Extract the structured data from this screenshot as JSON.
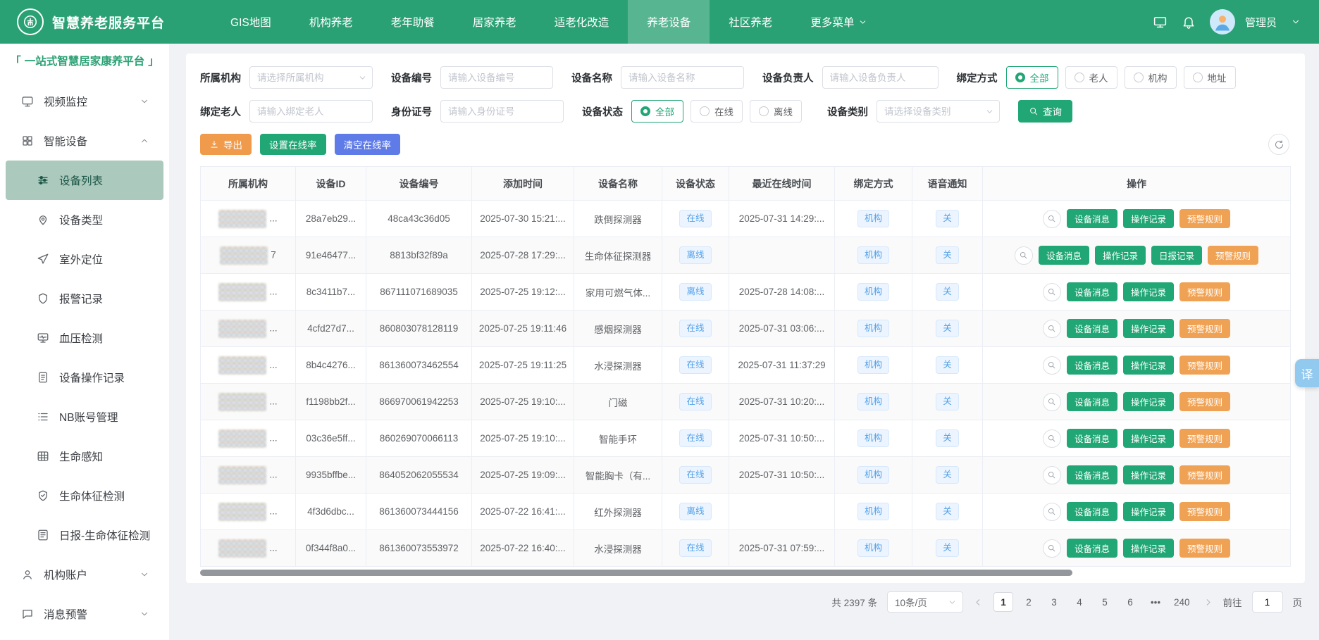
{
  "topbar": {
    "title": "智慧养老服务平台",
    "nav_items": [
      {
        "label": "GIS地图"
      },
      {
        "label": "机构养老"
      },
      {
        "label": "老年助餐"
      },
      {
        "label": "居家养老"
      },
      {
        "label": "适老化改造"
      },
      {
        "label": "养老设备",
        "active": true
      },
      {
        "label": "社区养老"
      },
      {
        "label": "更多菜单",
        "chevron": true
      }
    ],
    "user_name": "管理员"
  },
  "sidebar": {
    "bracket_left": "「",
    "platform_title": "一站式智慧居家康养平台",
    "bracket_right": "」",
    "items": [
      {
        "label": "视频监控",
        "icon": "monitor",
        "level": 1,
        "chevron": "down"
      },
      {
        "label": "智能设备",
        "icon": "grid",
        "level": 1,
        "chevron": "up"
      },
      {
        "label": "设备列表",
        "icon": "sliders",
        "level": 2,
        "active": true
      },
      {
        "label": "设备类型",
        "icon": "pin",
        "level": 2
      },
      {
        "label": "室外定位",
        "icon": "send",
        "level": 2
      },
      {
        "label": "报警记录",
        "icon": "shield",
        "level": 2
      },
      {
        "label": "血压检测",
        "icon": "pulse",
        "level": 2
      },
      {
        "label": "设备操作记录",
        "icon": "doc",
        "level": 2
      },
      {
        "label": "NB账号管理",
        "icon": "list",
        "level": 2
      },
      {
        "label": "生命感知",
        "icon": "table",
        "level": 2
      },
      {
        "label": "生命体征检测",
        "icon": "shieldcheck",
        "level": 2
      },
      {
        "label": "日报-生命体征检测",
        "icon": "report",
        "level": 2
      },
      {
        "label": "机构账户",
        "icon": "user",
        "level": 1,
        "chevron": "down"
      },
      {
        "label": "消息预警",
        "icon": "chat",
        "level": 1,
        "chevron": "down"
      }
    ]
  },
  "filters": {
    "org": {
      "label": "所属机构",
      "placeholder": "请选择所属机构"
    },
    "device_no": {
      "label": "设备编号",
      "placeholder": "请输入设备编号"
    },
    "device_name": {
      "label": "设备名称",
      "placeholder": "请输入设备名称"
    },
    "device_owner": {
      "label": "设备负责人",
      "placeholder": "请输入设备负责人"
    },
    "bind_mode": {
      "label": "绑定方式",
      "options": [
        "全部",
        "老人",
        "机构",
        "地址"
      ],
      "selected": "全部"
    },
    "bind_elder": {
      "label": "绑定老人",
      "placeholder": "请输入绑定老人"
    },
    "id_card": {
      "label": "身份证号",
      "placeholder": "请输入身份证号"
    },
    "device_status": {
      "label": "设备状态",
      "options": [
        "全部",
        "在线",
        "离线"
      ],
      "selected": "全部"
    },
    "device_type": {
      "label": "设备类别",
      "placeholder": "请选择设备类别"
    },
    "search_label": "查询"
  },
  "toolbar": {
    "export_label": "导出",
    "set_online_label": "设置在线率",
    "clear_online_label": "清空在线率"
  },
  "table": {
    "headers": [
      "所属机构",
      "设备ID",
      "设备编号",
      "添加时间",
      "设备名称",
      "设备状态",
      "最近在线时间",
      "绑定方式",
      "语音通知",
      "操作"
    ],
    "rows": [
      {
        "org": "...",
        "device_id": "28a7eb29...",
        "device_no": "48ca43c36d05",
        "added": "2025-07-30 15:21:...",
        "name": "跌倒探测器",
        "status": "在线",
        "last_online": "2025-07-31 14:29:...",
        "bind": "机构",
        "voice": "关",
        "actions": [
          {
            "label": "设备消息",
            "style": "green"
          },
          {
            "label": "操作记录",
            "style": "green"
          },
          {
            "label": "预警规则",
            "style": "orange"
          }
        ]
      },
      {
        "org": "7",
        "device_id": "91e46477...",
        "device_no": "8813bf32f89a",
        "added": "2025-07-28 17:29:...",
        "name": "生命体征探测器",
        "status": "离线",
        "last_online": "",
        "bind": "机构",
        "voice": "关",
        "actions": [
          {
            "label": "设备消息",
            "style": "green"
          },
          {
            "label": "操作记录",
            "style": "green"
          },
          {
            "label": "日报记录",
            "style": "green"
          },
          {
            "label": "预警规则",
            "style": "orange"
          }
        ]
      },
      {
        "org": "...",
        "device_id": "8c3411b7...",
        "device_no": "867111071689035",
        "added": "2025-07-25 19:12:...",
        "name": "家用可燃气体...",
        "status": "离线",
        "last_online": "2025-07-28 14:08:...",
        "bind": "机构",
        "voice": "关",
        "actions": [
          {
            "label": "设备消息",
            "style": "green"
          },
          {
            "label": "操作记录",
            "style": "green"
          },
          {
            "label": "预警规则",
            "style": "orange"
          }
        ]
      },
      {
        "org": "...",
        "device_id": "4cfd27d7...",
        "device_no": "860803078128119",
        "added": "2025-07-25 19:11:46",
        "name": "感烟探测器",
        "status": "在线",
        "last_online": "2025-07-31 03:06:...",
        "bind": "机构",
        "voice": "关",
        "actions": [
          {
            "label": "设备消息",
            "style": "green"
          },
          {
            "label": "操作记录",
            "style": "green"
          },
          {
            "label": "预警规则",
            "style": "orange"
          }
        ]
      },
      {
        "org": "...",
        "device_id": "8b4c4276...",
        "device_no": "861360073462554",
        "added": "2025-07-25 19:11:25",
        "name": "水浸探测器",
        "status": "在线",
        "last_online": "2025-07-31 11:37:29",
        "bind": "机构",
        "voice": "关",
        "actions": [
          {
            "label": "设备消息",
            "style": "green"
          },
          {
            "label": "操作记录",
            "style": "green"
          },
          {
            "label": "预警规则",
            "style": "orange"
          }
        ]
      },
      {
        "org": "...",
        "device_id": "f1198bb2f...",
        "device_no": "866970061942253",
        "added": "2025-07-25 19:10:...",
        "name": "门磁",
        "status": "在线",
        "last_online": "2025-07-31 10:20:...",
        "bind": "机构",
        "voice": "关",
        "actions": [
          {
            "label": "设备消息",
            "style": "green"
          },
          {
            "label": "操作记录",
            "style": "green"
          },
          {
            "label": "预警规则",
            "style": "orange"
          }
        ]
      },
      {
        "org": "...",
        "device_id": "03c36e5ff...",
        "device_no": "860269070066113",
        "added": "2025-07-25 19:10:...",
        "name": "智能手环",
        "status": "在线",
        "last_online": "2025-07-31 10:50:...",
        "bind": "机构",
        "voice": "关",
        "actions": [
          {
            "label": "设备消息",
            "style": "green"
          },
          {
            "label": "操作记录",
            "style": "green"
          },
          {
            "label": "预警规则",
            "style": "orange"
          }
        ]
      },
      {
        "org": "...",
        "device_id": "9935bffbe...",
        "device_no": "864052062055534",
        "added": "2025-07-25 19:09:...",
        "name": "智能胸卡（有...",
        "status": "在线",
        "last_online": "2025-07-31 10:50:...",
        "bind": "机构",
        "voice": "关",
        "actions": [
          {
            "label": "设备消息",
            "style": "green"
          },
          {
            "label": "操作记录",
            "style": "green"
          },
          {
            "label": "预警规则",
            "style": "orange"
          }
        ]
      },
      {
        "org": "...",
        "device_id": "4f3d6dbc...",
        "device_no": "861360073444156",
        "added": "2025-07-22 16:41:...",
        "name": "红外探测器",
        "status": "离线",
        "last_online": "",
        "bind": "机构",
        "voice": "关",
        "actions": [
          {
            "label": "设备消息",
            "style": "green"
          },
          {
            "label": "操作记录",
            "style": "green"
          },
          {
            "label": "预警规则",
            "style": "orange"
          }
        ]
      },
      {
        "org": "...",
        "device_id": "0f344f8a0...",
        "device_no": "861360073553972",
        "added": "2025-07-22 16:40:...",
        "name": "水浸探测器",
        "status": "在线",
        "last_online": "2025-07-31 07:59:...",
        "bind": "机构",
        "voice": "关",
        "actions": [
          {
            "label": "设备消息",
            "style": "green"
          },
          {
            "label": "操作记录",
            "style": "green"
          },
          {
            "label": "预警规则",
            "style": "orange"
          }
        ]
      }
    ]
  },
  "pagination": {
    "total_text": "共 2397 条",
    "page_size": "10条/页",
    "pages": [
      "1",
      "2",
      "3",
      "4",
      "5",
      "6",
      "•••",
      "240"
    ],
    "active_page": "1",
    "ellipsis": "•••",
    "goto_label": "前往",
    "goto_value": "1",
    "goto_suffix": "页"
  },
  "float": {
    "translate_label": "译"
  },
  "colors": {
    "primary_green": "#21a675",
    "topbar_green": "#2aa174",
    "warning_orange": "#f0a254",
    "action_blue": "#5f7be8",
    "tag_blue": "#53a0e8"
  }
}
